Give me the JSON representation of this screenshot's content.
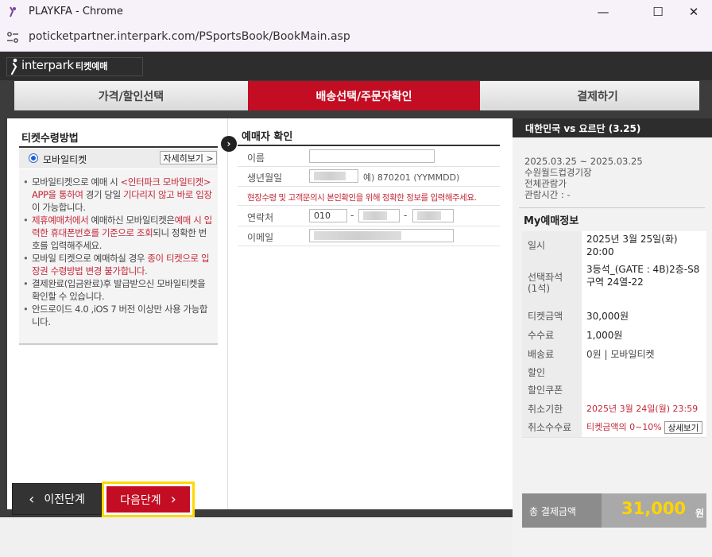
{
  "window": {
    "title": "PLAYKFA - Chrome",
    "controls": {
      "minimize": "—",
      "maximize": "☐",
      "close": "✕"
    }
  },
  "address": {
    "url": "poticketpartner.interpark.com/PSportsBook/BookMain.asp"
  },
  "brand": {
    "name": "interpark",
    "sub": "티켓예매"
  },
  "steps": [
    {
      "label": "가격/할인선택",
      "active": false
    },
    {
      "label": "배송선택/주문자확인",
      "active": true
    },
    {
      "label": "결제하기",
      "active": false
    }
  ],
  "ticket_method": {
    "title": "티켓수령방법",
    "option_label": "모바일티켓",
    "detail_button": "자세히보기 >",
    "notes": [
      [
        "모바일티켓으로 예매 시 ",
        "<인터파크 모바일티켓> APP을 통하여",
        " 경기 당일 ",
        "기다리지 않고 바로 입장",
        "이 가능합니다."
      ],
      [
        "제휴예매처에서",
        " 예매하신 모바일티켓은",
        "예매 시 입력한 휴대폰번호를 기준으로 조회",
        "되니 정확한 번호를 입력해주세요."
      ],
      [
        "모바일 티켓으로 예매하실 경우 ",
        "종이 티켓으로 입장권 수령방법 변경 불가합니다."
      ],
      [
        "결제완료(입금완료)후 발급받으신 모바일티켓을 확인할 수 있습니다."
      ],
      [
        "안드로이드 4.0 ,iOS 7 버전 이상만 사용 가능합니다."
      ]
    ]
  },
  "buyer": {
    "title": "예매자 확인",
    "name_label": "이름",
    "name_value": "",
    "birth_label": "생년월일",
    "birth_hint": "예) 870201 (YYMMDD)",
    "warning": "현장수령 및 고객문의시 본인확인을 위해 정확한 정보를 입력해주세요.",
    "phone_label": "연락처",
    "phone_prefix": "010",
    "phone_sep": "-",
    "email_label": "이메일"
  },
  "summary": {
    "event": "대한민국 vs 요르단 (3.25)",
    "dates": "2025.03.25 ~ 2025.03.25",
    "venue": "수원월드컵경기장",
    "rating": "전체관람가",
    "runtime": "관람시간 : -",
    "my_title": "My예매정보",
    "rows": [
      {
        "label": "일시",
        "value": "2025년 3월 25일(화) 20:00"
      },
      {
        "label": "선택좌석\n(1석)",
        "value": "3등석_(GATE : 4B)2층-S8구역 24열-22"
      },
      {
        "label": "티켓금액",
        "value": "30,000원"
      },
      {
        "label": "수수료",
        "value": "1,000원"
      },
      {
        "label": "배송료",
        "value": "0원 | 모바일티켓"
      },
      {
        "label": "할인",
        "value": ""
      },
      {
        "label": "할인쿠폰",
        "value": ""
      },
      {
        "label": "취소기한",
        "value": "2025년 3월 24일(월) 23:59"
      },
      {
        "label": "취소수수료",
        "value": "티켓금액의 0~10%",
        "button": "상세보기"
      }
    ],
    "total_label": "총 결제금액",
    "total_value": "31,000",
    "total_unit": "원"
  },
  "buttons": {
    "prev": "이전단계",
    "next": "다음단계"
  },
  "colors": {
    "accent": "#c30d23",
    "highlight": "#ffd800",
    "total": "#ffd400"
  }
}
